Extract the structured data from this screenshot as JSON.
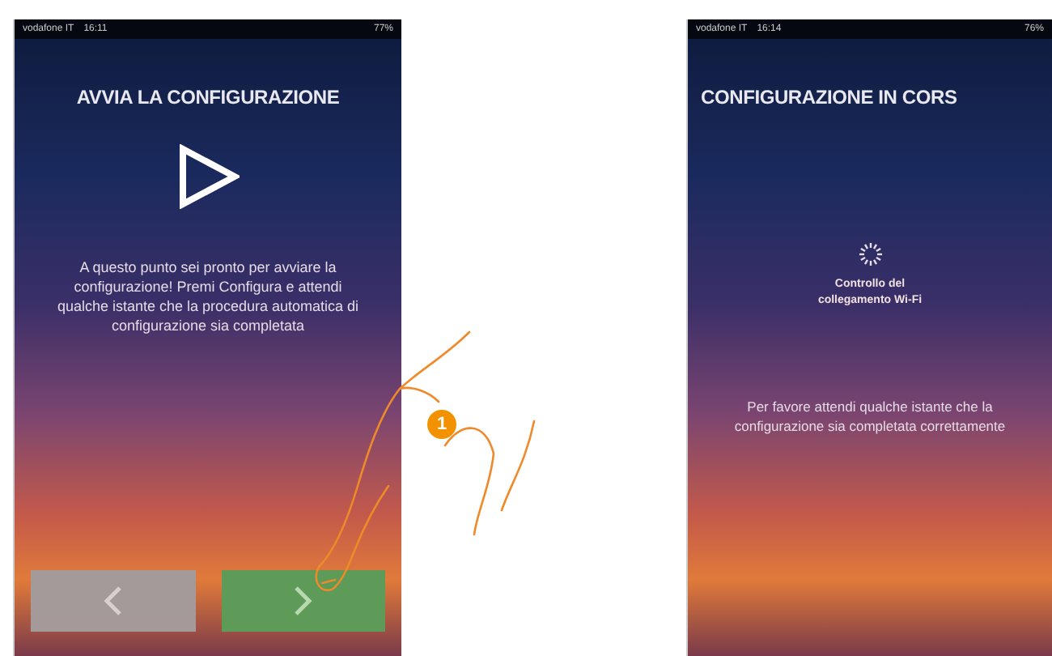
{
  "screens": [
    {
      "kind": "start",
      "status": {
        "carrier": "vodafone IT",
        "time": "16:11",
        "battery": "77%"
      },
      "title": "AVVIA LA CONFIGURAZIONE",
      "message": "A questo punto sei pronto per avviare la configurazione! Premi Configura e attendi qualche istante che la procedura automatica di configurazione sia completata",
      "buttons": [
        {
          "kind": "back",
          "disabled": true
        },
        {
          "kind": "next",
          "disabled": false
        }
      ]
    },
    {
      "kind": "progress",
      "status": {
        "carrier": "vodafone IT",
        "time": "16:14",
        "battery": "76%"
      },
      "title": "CONFIGURAZIONE IN CORS",
      "progress_label": "Controllo del collegamento Wi-Fi",
      "message": "Per favore attendi qualche istante che la configurazione sia completata correttamente"
    }
  ],
  "callout": {
    "number": "1"
  }
}
